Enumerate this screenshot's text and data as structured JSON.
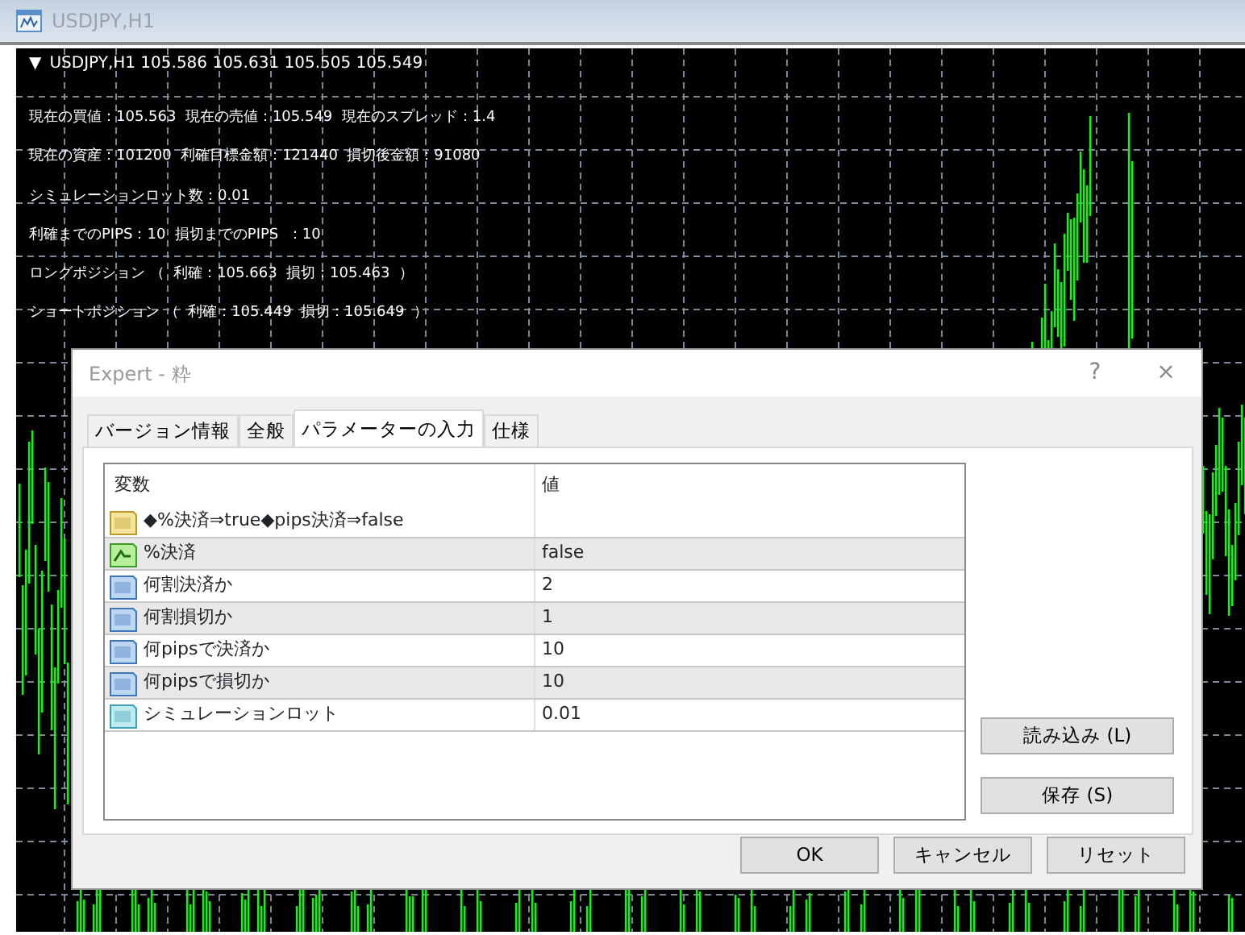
{
  "window": {
    "title": "USDJPY,H1"
  },
  "chart": {
    "header": "USDJPY,H1  105.586 105.631 105.505 105.549",
    "collapse_glyph": "▼",
    "info_lines": [
      "現在の買値：105.563  現在の売値：105.549  現在のスプレッド：1.4",
      "現在の資産：101200  利確目標金額：121440  損切後金額：91080",
      "シミュレーションロット数：0.01",
      "利確までのPIPS：10  損切までのPIPS  ：10",
      "ロングポジション （  利確：105.663  損切：105.463  ）",
      "ショートポジション （  利確：105.449  損切：105.649  ）"
    ]
  },
  "dialog": {
    "title": "Expert - 粋",
    "help": "?",
    "close": "×",
    "tabs": [
      {
        "label": "バージョン情報",
        "selected": false
      },
      {
        "label": "全般",
        "selected": false
      },
      {
        "label": "パラメーターの入力",
        "selected": true
      },
      {
        "label": "仕様",
        "selected": false
      }
    ],
    "table": {
      "columns": [
        "変数",
        "値"
      ],
      "rows": [
        {
          "kind": "string",
          "name": "◆%決済⇒true◆pips決済⇒false"
        },
        {
          "kind": "bool",
          "name": "%決済",
          "value": "false"
        },
        {
          "kind": "int",
          "name": "何割決済か",
          "value": "2"
        },
        {
          "kind": "int",
          "name": "何割損切か",
          "value": "1"
        },
        {
          "kind": "int",
          "name": "何pipsで決済か",
          "value": "10"
        },
        {
          "kind": "int",
          "name": "何pipsで損切か",
          "value": "10"
        },
        {
          "kind": "double",
          "name": "シミュレーションロット",
          "value": "0.01"
        }
      ]
    },
    "side_buttons": [
      "読み込み (L)",
      "保存 (S)"
    ],
    "buttons": [
      "OK",
      "キャンセル",
      "リセット"
    ]
  }
}
